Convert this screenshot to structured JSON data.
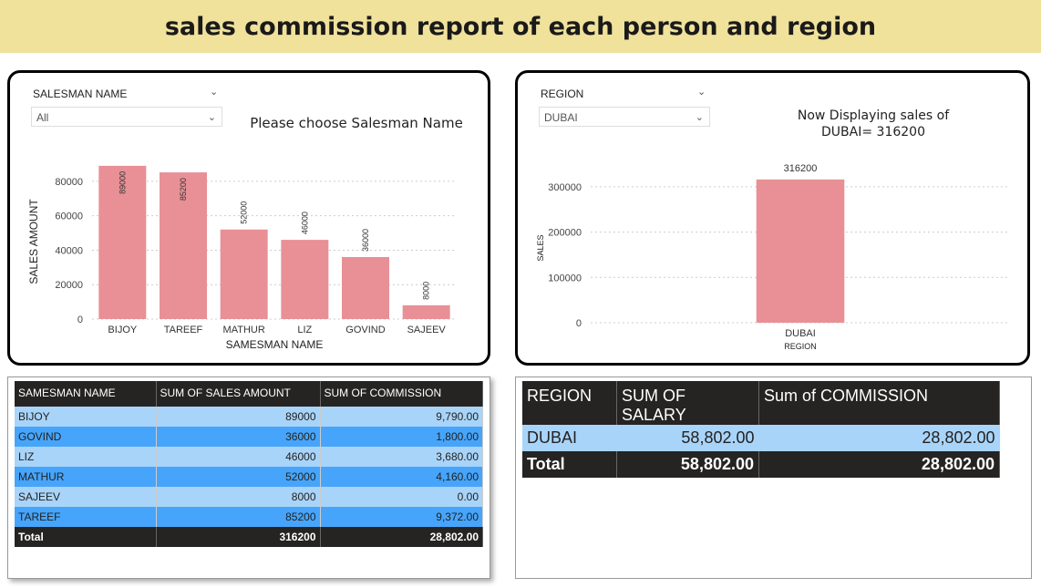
{
  "header": {
    "title": "sales commission report of each person and region"
  },
  "left_panel": {
    "slicer_title": "SALESMAN NAME",
    "slicer_value": "All",
    "message": "Please choose Salesman Name"
  },
  "right_panel": {
    "slicer_title": "REGION",
    "slicer_value": "DUBAI",
    "message_line1": "Now Displaying sales of",
    "message_line2": "DUBAI= 316200"
  },
  "colors": {
    "bar": "#e89096",
    "header_bg": "#f0e19b",
    "table_dark": "#252423",
    "row_light": "#a9d4f9",
    "row_dark": "#46a5fb"
  },
  "chart_data": [
    {
      "type": "bar",
      "categories": [
        "BIJOY",
        "TAREEF",
        "MATHUR",
        "LIZ",
        "GOVIND",
        "SAJEEV"
      ],
      "values": [
        89000,
        85200,
        52000,
        46000,
        36000,
        8000
      ],
      "data_labels": [
        "89000",
        "85200",
        "52000",
        "46000",
        "36000",
        "8000"
      ],
      "xlabel": "SAMESMAN NAME",
      "ylabel": "SALES AMOUNT",
      "yticks": [
        0,
        20000,
        40000,
        60000,
        80000
      ],
      "ylim": [
        0,
        90000
      ],
      "grid": true
    },
    {
      "type": "bar",
      "categories": [
        "DUBAI"
      ],
      "values": [
        316200
      ],
      "data_labels": [
        "316200"
      ],
      "xlabel": "REGION",
      "ylabel": "SALES",
      "yticks": [
        0,
        100000,
        200000,
        300000
      ],
      "ylim": [
        0,
        330000
      ],
      "grid": true
    }
  ],
  "salesman_table": {
    "headers": [
      "SAMESMAN NAME",
      "SUM OF SALES AMOUNT",
      "SUM OF COMMISSION"
    ],
    "rows": [
      [
        "BIJOY",
        "89000",
        "9,790.00"
      ],
      [
        "GOVIND",
        "36000",
        "1,800.00"
      ],
      [
        "LIZ",
        "46000",
        "3,680.00"
      ],
      [
        "MATHUR",
        "52000",
        "4,160.00"
      ],
      [
        "SAJEEV",
        "8000",
        "0.00"
      ],
      [
        "TAREEF",
        "85200",
        "9,372.00"
      ]
    ],
    "total": [
      "Total",
      "316200",
      "28,802.00"
    ]
  },
  "region_table": {
    "headers": [
      "REGION",
      "SUM OF SALARY",
      "Sum of COMMISSION"
    ],
    "rows": [
      [
        "DUBAI",
        "58,802.00",
        "28,802.00"
      ]
    ],
    "total": [
      "Total",
      "58,802.00",
      "28,802.00"
    ]
  }
}
